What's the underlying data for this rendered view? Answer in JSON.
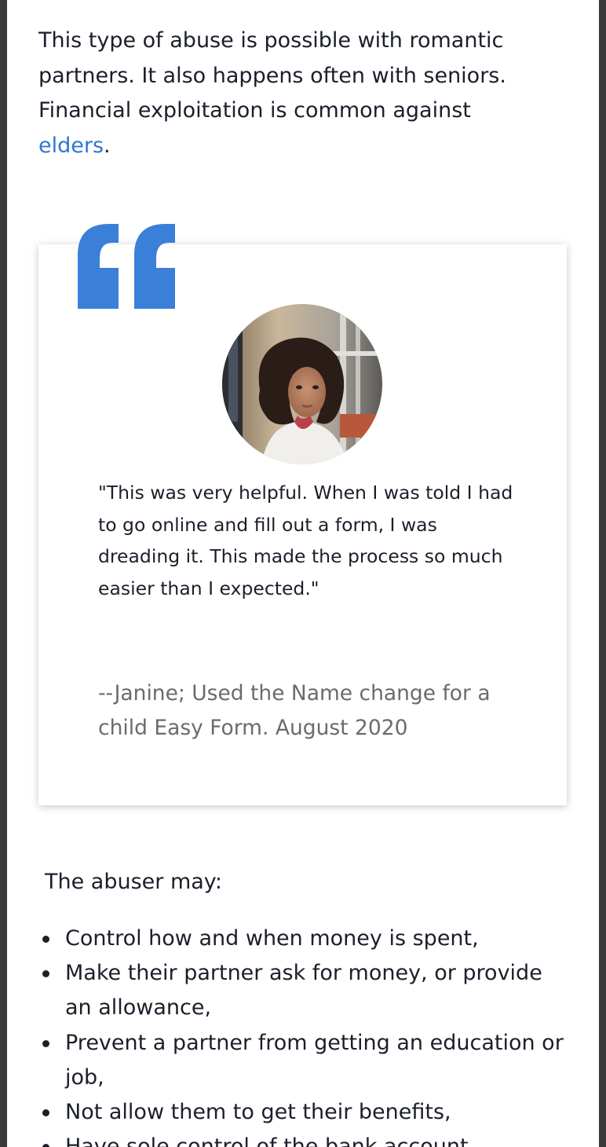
{
  "intro": {
    "text_before_link": "This type of abuse is possible with romantic partners. It also happens often with seniors. Financial exploitation is common against ",
    "link_text": "elders",
    "text_after_link": "."
  },
  "testimonial": {
    "quote": "\"This was very helpful. When I was told I had to go online and fill out a form, I was dreading it. This made the process so much easier than I expected.\"",
    "attribution": "--Janine; Used the Name change for a child Easy Form. August 2020",
    "accent_color": "#3a7fd8"
  },
  "abuser_section": {
    "heading": "The abuser may:",
    "items": [
      "Control how and when money is spent,",
      "Make their partner ask for money, or provide an allowance,",
      "Prevent a partner from getting an education or job,",
      "Not allow them to get their benefits,",
      "Have sole control of the bank account,"
    ]
  },
  "colors": {
    "link": "#2f77d0",
    "body_text": "#1b1f2a",
    "attribution_text": "#6b6b6b",
    "frame": "#3a3a3a"
  }
}
